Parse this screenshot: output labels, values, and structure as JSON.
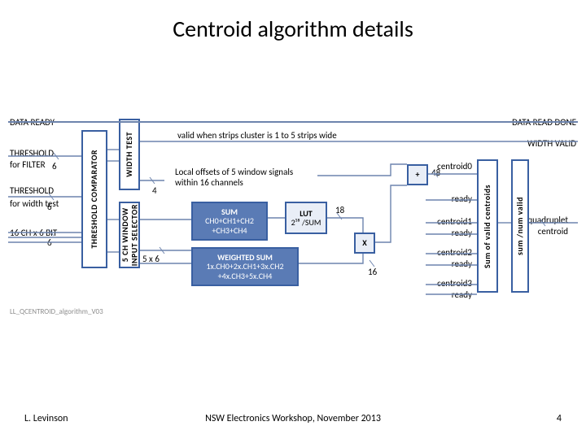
{
  "title": "Centroid algorithm details",
  "footer": {
    "left": "L. Levinson",
    "center": "NSW Electronics Workshop, November 2013",
    "page": "4"
  },
  "diagram_caption": "LL_QCENTROID_algorithm_V03",
  "io": {
    "data_ready": "DATA READY",
    "threshold_filter_a": "THRESHOLD",
    "threshold_filter_b": "for FILTER",
    "threshold_width_a": "THRESHOLD",
    "threshold_width_b": "for width test",
    "ch_label": "16 CH x 6 BIT",
    "data_read_done": "DATA READ DONE",
    "width_valid": "WIDTH VALID",
    "quadruplet_a": "quadruplet",
    "quadruplet_b": "centroid"
  },
  "blocks": {
    "thresh_comp": "THRESHOLD COMPARATOR",
    "width_test": "WIDTH TEST",
    "input_sel_a": "5 CH WINDOW",
    "input_sel_b": "INPUT SELECTOR",
    "valid_text": "valid when strips cluster is 1 to 5 strips wide",
    "offsets_a": "Local offsets of 5 window signals",
    "offsets_b": "within 16 channels",
    "sum_title": "SUM",
    "sum_body": "CH0+CH1+CH2\n+CH3+CH4",
    "lut_title": "LUT",
    "lut_body": "2¹⁸ /SUM",
    "wsum_title": "WEIGHTED SUM",
    "wsum_body": "1x.CH0+2x.CH1+3x.CH2\n+4x.CH3+5x.CH4",
    "mult": "X",
    "add": "+",
    "sum_valid_a": "Sum of valid centroids",
    "sum_valid_b": "sum /num valid"
  },
  "signals": {
    "centroid0": "centroid0",
    "centroid1": "centroid1",
    "centroid2": "centroid2",
    "centroid3": "centroid3",
    "ready": "ready"
  },
  "widths": {
    "six_a": "6",
    "six_b": "6",
    "six_c": "6",
    "four": "4",
    "five_x6": "5 x 6",
    "eighteen": "18",
    "sixteen": "16",
    "fortyeight": "48"
  }
}
